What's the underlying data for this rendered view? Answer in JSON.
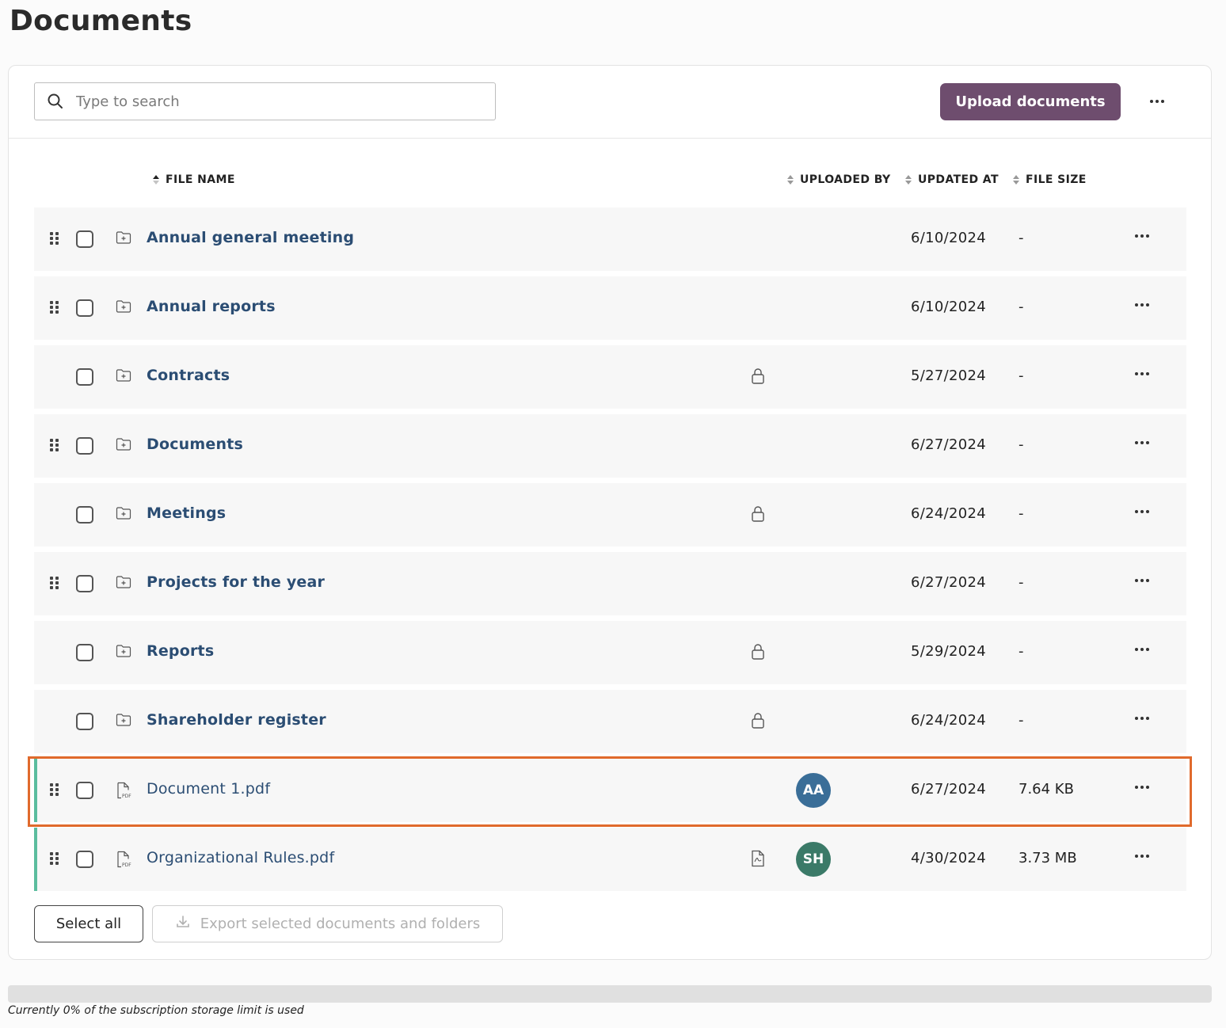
{
  "page": {
    "title": "Documents"
  },
  "toolbar": {
    "search_placeholder": "Type to search",
    "upload_label": "Upload documents"
  },
  "table": {
    "columns": {
      "file_name": "FILE NAME",
      "uploaded_by": "UPLOADED BY",
      "updated_at": "UPDATED AT",
      "file_size": "FILE SIZE"
    },
    "rows": [
      {
        "type": "folder",
        "name": "Annual general meeting",
        "locked": false,
        "draggable": true,
        "uploaded_by": "",
        "updated_at": "6/10/2024",
        "size": "-"
      },
      {
        "type": "folder",
        "name": "Annual reports",
        "locked": false,
        "draggable": true,
        "uploaded_by": "",
        "updated_at": "6/10/2024",
        "size": "-"
      },
      {
        "type": "folder",
        "name": "Contracts",
        "locked": true,
        "draggable": false,
        "uploaded_by": "",
        "updated_at": "5/27/2024",
        "size": "-"
      },
      {
        "type": "folder",
        "name": "Documents",
        "locked": false,
        "draggable": true,
        "uploaded_by": "",
        "updated_at": "6/27/2024",
        "size": "-"
      },
      {
        "type": "folder",
        "name": "Meetings",
        "locked": true,
        "draggable": false,
        "uploaded_by": "",
        "updated_at": "6/24/2024",
        "size": "-"
      },
      {
        "type": "folder",
        "name": "Projects for the year",
        "locked": false,
        "draggable": true,
        "uploaded_by": "",
        "updated_at": "6/27/2024",
        "size": "-"
      },
      {
        "type": "folder",
        "name": "Reports",
        "locked": true,
        "draggable": false,
        "uploaded_by": "",
        "updated_at": "5/29/2024",
        "size": "-"
      },
      {
        "type": "folder",
        "name": "Shareholder register",
        "locked": true,
        "draggable": false,
        "uploaded_by": "",
        "updated_at": "6/24/2024",
        "size": "-"
      },
      {
        "type": "file",
        "name": "Document 1.pdf",
        "locked": false,
        "draggable": true,
        "uploaded_by": "AA",
        "avatar_color": "#3a6e98",
        "updated_at": "6/27/2024",
        "size": "7.64 KB"
      },
      {
        "type": "file",
        "name": "Organizational Rules.pdf",
        "locked": false,
        "draggable": true,
        "has_doc_icon": true,
        "uploaded_by": "SH",
        "avatar_color": "#3b7a68",
        "updated_at": "4/30/2024",
        "size": "3.73 MB"
      }
    ]
  },
  "footer": {
    "select_all_label": "Select all",
    "export_label": "Export selected documents and folders"
  },
  "storage": {
    "percent_used": 0,
    "text": "Currently 0% of the subscription storage limit is used"
  },
  "colors": {
    "primary": "#6e4d6e",
    "link": "#2b4d73",
    "file_accent": "#5bbd9e",
    "highlight": "#e06a2c"
  }
}
